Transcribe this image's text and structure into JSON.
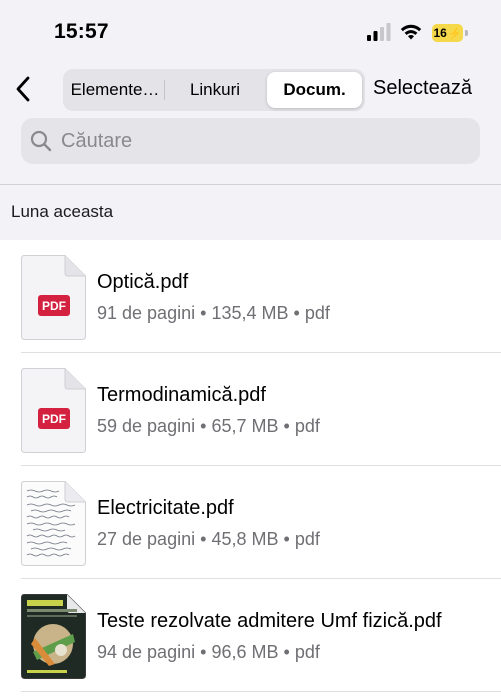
{
  "status_bar": {
    "time": "15:57",
    "battery": "16"
  },
  "nav": {
    "segments": [
      "Elemente…",
      "Linkuri",
      "Docum."
    ],
    "selected_segment": "Docum.",
    "select_label": "Selectează"
  },
  "search": {
    "placeholder": "Căutare"
  },
  "section": {
    "header": "Luna aceasta"
  },
  "pdf_badge": "PDF",
  "meta_separator": "•",
  "documents": [
    {
      "name": "Optică.pdf",
      "pages": "91 de pagini",
      "size": "135,4 MB",
      "type": "pdf",
      "thumbnail": "pdf-badge"
    },
    {
      "name": "Termodinamică.pdf",
      "pages": "59 de pagini",
      "size": "65,7 MB",
      "type": "pdf",
      "thumbnail": "pdf-badge"
    },
    {
      "name": "Electricitate.pdf",
      "pages": "27 de pagini",
      "size": "45,8 MB",
      "type": "pdf",
      "thumbnail": "handwritten-page"
    },
    {
      "name": "Teste rezolvate admitere Umf fizică.pdf",
      "pages": "94 de pagini",
      "size": "96,6 MB",
      "type": "pdf",
      "thumbnail": "book-cover"
    }
  ],
  "colors": {
    "background": "#f2f2f7",
    "pdf_badge": "#d3213f",
    "battery": "#f5d94b",
    "secondary_text": "#6f6f74"
  }
}
